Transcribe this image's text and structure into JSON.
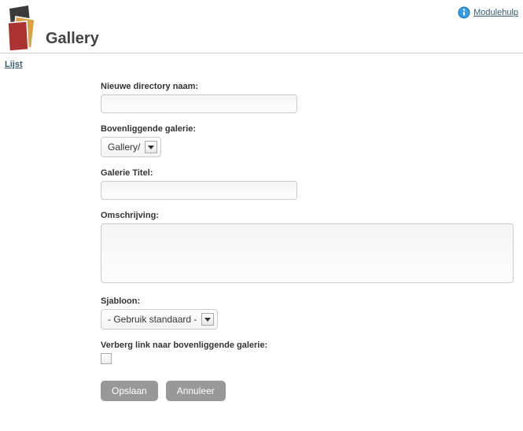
{
  "header": {
    "title": "Gallery",
    "help_label": "Modulehulp"
  },
  "nav": {
    "list_link": "Lijst"
  },
  "form": {
    "dir_label": "Nieuwe directory naam:",
    "dir_value": "",
    "parent_label": "Bovenliggende galerie:",
    "parent_selected": "Gallery/",
    "title_label": "Galerie Titel:",
    "title_value": "",
    "desc_label": "Omschrijving:",
    "desc_value": "",
    "template_label": "Sjabloon:",
    "template_selected": "- Gebruik standaard -",
    "hide_label": "Verberg link naar bovenliggende galerie:",
    "save_label": "Opslaan",
    "cancel_label": "Annuleer"
  }
}
